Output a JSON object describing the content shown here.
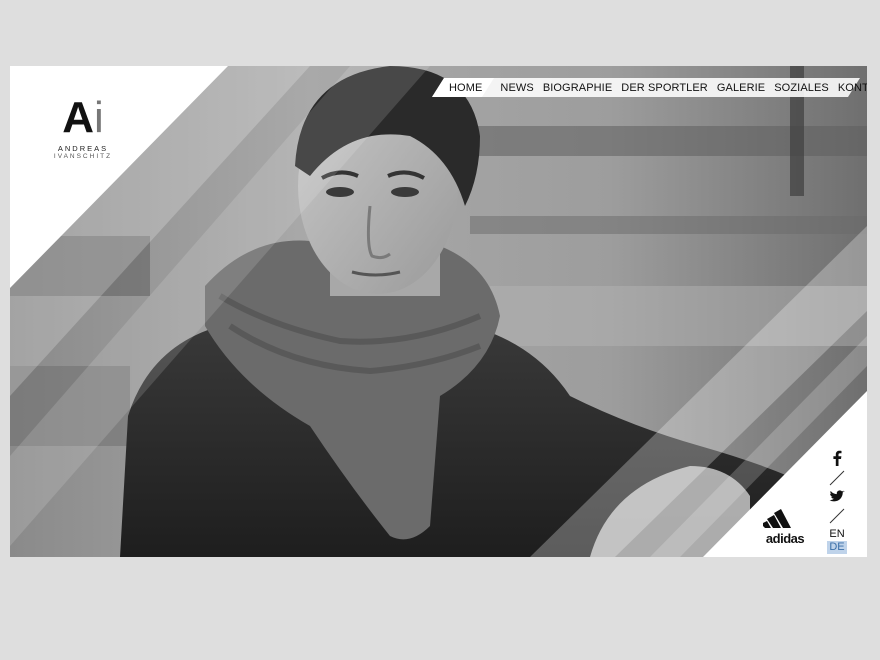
{
  "logo": {
    "monogram_a": "A",
    "monogram_i": "i",
    "name": "ANDREAS",
    "surname": "IVANSCHITZ"
  },
  "nav": {
    "items": [
      "HOME",
      "NEWS",
      "BIOGRAPHIE",
      "DER SPORTLER",
      "GALERIE",
      "SOZIALES",
      "KONTAKT"
    ],
    "active": "HOME"
  },
  "social": {
    "icons": [
      "facebook-icon",
      "twitter-icon"
    ],
    "languages": [
      "EN",
      "DE"
    ],
    "selected_language": "DE"
  },
  "sponsor": {
    "name": "adidas"
  },
  "colors": {
    "highlight": "#bfd3ea",
    "panel": "#ffffff",
    "text": "#111111"
  }
}
